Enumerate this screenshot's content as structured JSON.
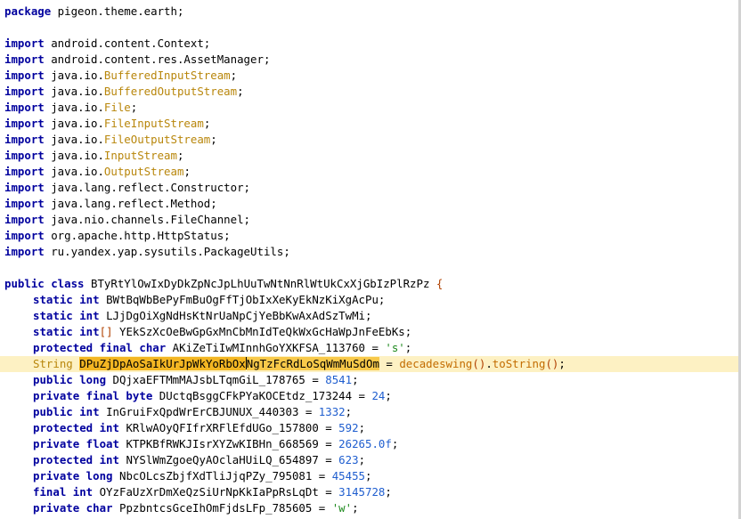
{
  "lines": [
    {
      "kind": "package",
      "kw": "package",
      "text": " pigeon.theme.earth;"
    },
    {
      "kind": "blank"
    },
    {
      "kind": "import",
      "kw": "import",
      "text": " android.content.Context;"
    },
    {
      "kind": "import",
      "kw": "import",
      "text": " android.content.res.AssetManager;"
    },
    {
      "kind": "import-typed",
      "kw": "import",
      "pre": " java.io.",
      "type": "BufferedInputStream",
      "post": ";"
    },
    {
      "kind": "import-typed",
      "kw": "import",
      "pre": " java.io.",
      "type": "BufferedOutputStream",
      "post": ";"
    },
    {
      "kind": "import-typed",
      "kw": "import",
      "pre": " java.io.",
      "type": "File",
      "post": ";"
    },
    {
      "kind": "import-typed",
      "kw": "import",
      "pre": " java.io.",
      "type": "FileInputStream",
      "post": ";"
    },
    {
      "kind": "import-typed",
      "kw": "import",
      "pre": " java.io.",
      "type": "FileOutputStream",
      "post": ";"
    },
    {
      "kind": "import-typed",
      "kw": "import",
      "pre": " java.io.",
      "type": "InputStream",
      "post": ";"
    },
    {
      "kind": "import-typed",
      "kw": "import",
      "pre": " java.io.",
      "type": "OutputStream",
      "post": ";"
    },
    {
      "kind": "import",
      "kw": "import",
      "text": " java.lang.reflect.Constructor;"
    },
    {
      "kind": "import",
      "kw": "import",
      "text": " java.lang.reflect.Method;"
    },
    {
      "kind": "import",
      "kw": "import",
      "text": " java.nio.channels.FileChannel;"
    },
    {
      "kind": "import",
      "kw": "import",
      "text": " org.apache.http.HttpStatus;"
    },
    {
      "kind": "import",
      "kw": "import",
      "text": " ru.yandex.yap.sysutils.PackageUtils;"
    },
    {
      "kind": "blank"
    },
    {
      "kind": "class",
      "kw": "public class",
      "name": " BTyRtYlOwIxDyDkZpNcJpLhUuTwNtNnRlWtUkCxXjGbIzPlRzPz ",
      "brace": "{"
    }
  ],
  "fields": [
    {
      "mods": "static int",
      "name": " BWtBqWbBePyFmBuOgFfTjObIxXeKyEkNzKiXgAcPu;"
    },
    {
      "mods": "static int",
      "name": " LJjDgOiXgNdHsKtNrUaNpCjYeBbKwAxAdSzTwMi;"
    },
    {
      "mods": "static int",
      "bracket": "[]",
      "name": " YEkSzXcOeBwGpGxMnCbMnIdTeQkWxGcHaWpJnFeEbKs;"
    },
    {
      "mods": "protected final char",
      "name": " AKiZeTiIwMInnhGoYXKFSA_113760 = ",
      "value": "'s'",
      "vtype": "str",
      "end": ";"
    },
    {
      "current": true,
      "type": "String",
      "sel1": "DPuZjDpAoSaIkUrJpWkYoRbOx",
      "sel2": "NgTzFcRdLoSqWmMuSdOm",
      "rest1": " = ",
      "call": "decadeswing",
      "paren1": "()",
      "rest2": ".",
      "call2": "toString",
      "paren2": "()",
      "end": ";"
    },
    {
      "mods": "public long",
      "name": " DQjxaEFTMmMAJsbLTqmGiL_178765 = ",
      "value": "8541",
      "vtype": "num",
      "end": ";"
    },
    {
      "mods": "private final byte",
      "name": " DUctqBsggCFkPYaKOCEtdz_173244 = ",
      "value": "24",
      "vtype": "num",
      "end": ";"
    },
    {
      "mods": "public int",
      "name": " InGruiFxQpdWrErCBJUNUX_440303 = ",
      "value": "1332",
      "vtype": "num",
      "end": ";"
    },
    {
      "mods": "protected int",
      "name": " KRlwAOyQFIfrXRFlEfdUGo_157800 = ",
      "value": "592",
      "vtype": "num",
      "end": ";"
    },
    {
      "mods": "private float",
      "name": " KTPKBfRWKJIsrXYZwKIBHn_668569 = ",
      "value": "26265.0f",
      "vtype": "num",
      "end": ";"
    },
    {
      "mods": "protected int",
      "name": " NYSlWmZgoeQyAOclaHUiLQ_654897 = ",
      "value": "623",
      "vtype": "num",
      "end": ";"
    },
    {
      "mods": "private long",
      "name": " NbcOLcsZbjfXdTliJjqPZy_795081 = ",
      "value": "45455",
      "vtype": "num",
      "end": ";"
    },
    {
      "mods": "final int",
      "name": " OYzFaUzXrDmXeQzSiUrNpKkIaPpRsLqDt = ",
      "value": "3145728",
      "vtype": "num",
      "end": ";"
    },
    {
      "mods": "private char",
      "name": " PpzbntcsGceIhOmFjdsLFp_785605 = ",
      "value": "'w'",
      "vtype": "str",
      "end": ";"
    }
  ]
}
